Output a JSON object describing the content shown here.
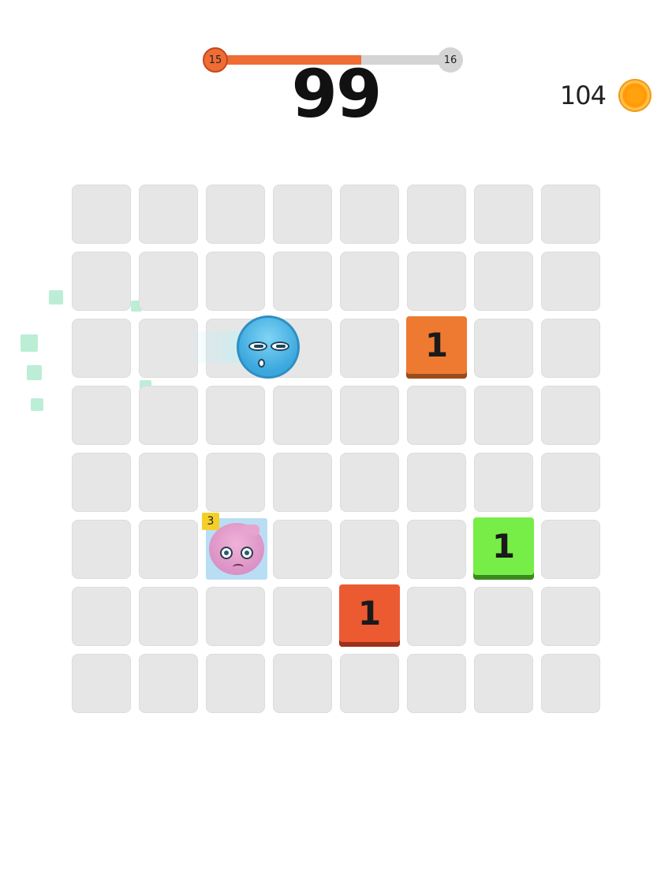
{
  "level": {
    "current": "15",
    "next": "16",
    "progress_fraction": 0.62
  },
  "score": "99",
  "coins": {
    "count": "104",
    "icon": "coin-icon"
  },
  "board": {
    "rows": 8,
    "cols": 8
  },
  "blocks": [
    {
      "label": "1",
      "row": 2,
      "col": 5,
      "color": "#ee7a32",
      "shade": "#9b4c1b"
    },
    {
      "label": "1",
      "row": 5,
      "col": 6,
      "color": "#77ee47",
      "shade": "#3a8a1f"
    },
    {
      "label": "1",
      "row": 6,
      "col": 4,
      "color": "#ec5a32",
      "shade": "#9b3219"
    }
  ],
  "ball": {
    "icon": "blue-ball-icon",
    "color": "#4ab3e3"
  },
  "enemy": {
    "icon": "pink-blob-icon",
    "hit_points": "3"
  },
  "colors": {
    "accent": "#ef6c35",
    "cell": "#e6e6e6",
    "particle": "#a6e8c7",
    "hp_badge": "#f4cf2a"
  }
}
